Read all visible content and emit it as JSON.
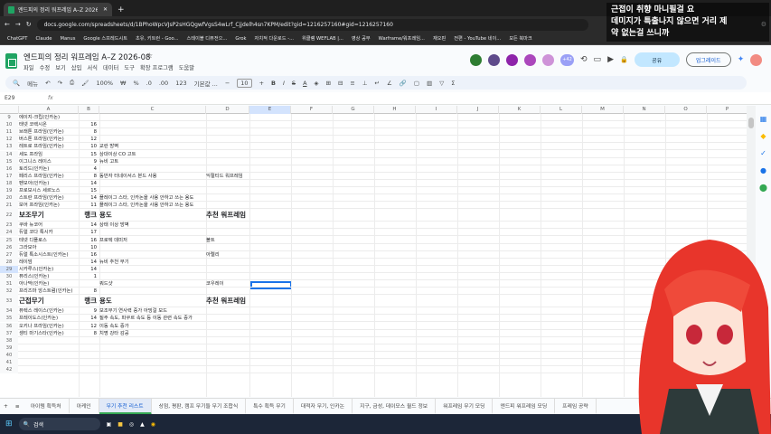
{
  "browser": {
    "tab_title": "엔드피의 정리 워프레임 A–Z 2026-08",
    "url": "docs.google.com/spreadsheets/d/1BPhoWpcVJsP2sHGQgwfVgsS4wLrf_Cjjdelh4sn7KPM/edit?gid=1216257160#gid=1216257160",
    "bookmarks": [
      "ChatGPT",
      "Claude",
      "Manus",
      "Google 스프레드시트",
      "초유, 키트런 - Goo...",
      "스테이블 디퓨전으...",
      "Grok",
      "자치적 다운로드 -...",
      "위클램 WEFLAB |...",
      "영상 공부",
      "Warframe/워프레임...",
      "재오핀",
      "전편 - YouTube 네이..."
    ],
    "bookmarks_more": "모든 북마크"
  },
  "doc": {
    "title": "엔드피의 정리 워프레임 A–Z 2026-08",
    "menus": [
      "파일",
      "수정",
      "보기",
      "삽입",
      "서식",
      "데이터",
      "도구",
      "확장 프로그램",
      "도움말"
    ],
    "share": "공유",
    "upgrade": "업그레이드",
    "viewers_extra": "+42"
  },
  "toolbar": {
    "search": "메뉴",
    "zoom": "100%",
    "percent": "%",
    "decimal_dec": ".0",
    "decimal_inc": ".00",
    "num_fmt": "123",
    "font": "기본값 ...",
    "font_size": "10"
  },
  "formula": {
    "cell": "E29",
    "fx": "fx"
  },
  "columns": [
    "A",
    "B",
    "C",
    "D",
    "E",
    "F",
    "G",
    "H",
    "I",
    "J",
    "K",
    "L",
    "M",
    "N",
    "O",
    "P"
  ],
  "rows": [
    {
      "n": "9",
      "a": "에이지-크립(인카논)",
      "b": "",
      "c": "",
      "d": ""
    },
    {
      "n": "10",
      "a": "태넷 코렉시온",
      "b": "16",
      "c": "",
      "d": ""
    },
    {
      "n": "11",
      "a": "브래톤 프라임(인카논)",
      "b": "8",
      "c": "",
      "d": ""
    },
    {
      "n": "12",
      "a": "버스톤 프라임(인카논)",
      "b": "12",
      "c": "",
      "d": ""
    },
    {
      "n": "13",
      "a": "레트로 프라임(인카논)",
      "b": "10",
      "c": "교란 방벽",
      "d": ""
    },
    {
      "n": "14",
      "a": "세도 프라임",
      "b": "15",
      "c": "상대이상 CO 고트",
      "d": ""
    },
    {
      "n": "15",
      "a": "이그니스 레이스",
      "b": "9",
      "c": "뉴비 고트",
      "d": ""
    },
    {
      "n": "16",
      "a": "토리드(인카논)",
      "b": "4",
      "c": "",
      "d": ""
    },
    {
      "n": "17",
      "a": "페리스 프라임(인카논)",
      "b": "8",
      "c": "동반자 터네이서스 본드 사용",
      "d": "익절티드 워프레임"
    },
    {
      "n": "18",
      "a": "펜모아(인카논)",
      "b": "14",
      "c": "",
      "d": ""
    },
    {
      "n": "19",
      "a": "프로보시스 세르노스",
      "b": "15",
      "c": "",
      "d": ""
    },
    {
      "n": "20",
      "a": "스트란 프라임(인카논)",
      "b": "14",
      "c": "플레이그 스타, 인카논을 사용 안하고 쓰는 용도",
      "d": ""
    },
    {
      "n": "21",
      "a": "보어 프라임(인카논)",
      "b": "11",
      "c": "플레이그 스타, 인카논을 사용 안하고 쓰는 용도",
      "d": ""
    },
    {
      "n": "22",
      "a": "보조무기",
      "b": "랭크",
      "c": "용도",
      "d": "추천 워프레임",
      "hd": true
    },
    {
      "n": "23",
      "a": "쿠바 뉴코어",
      "b": "14",
      "c": "상태 이상 방벽",
      "d": ""
    },
    {
      "n": "24",
      "a": "듀얼 코다 톡시카",
      "b": "17",
      "c": "",
      "d": ""
    },
    {
      "n": "25",
      "a": "테넷 디플로스",
      "b": "16",
      "c": "프로텍 데미저",
      "d": "볼트"
    },
    {
      "n": "26",
      "a": "그라모아",
      "b": "10",
      "c": "",
      "d": ""
    },
    {
      "n": "27",
      "a": "듀얼 톡소시스트(인카논)",
      "b": "16",
      "c": "",
      "d": "아렐리"
    },
    {
      "n": "28",
      "a": "레이덤",
      "b": "14",
      "c": "뉴비 추천 무기",
      "d": ""
    },
    {
      "n": "29",
      "a": "시카루스(인카논)",
      "b": "14",
      "c": "",
      "d": ""
    },
    {
      "n": "30",
      "a": "퓨리스(인카논)",
      "b": "1",
      "c": "",
      "d": ""
    },
    {
      "n": "31",
      "a": "아나막(인카논)",
      "b": "",
      "c": "쿼드샷",
      "d": "코우레이"
    },
    {
      "n": "32",
      "a": "프리즈마 앙스트럼(인카논)",
      "b": "8",
      "c": "",
      "d": ""
    },
    {
      "n": "33",
      "a": "근접무기",
      "b": "랭크",
      "c": "용도",
      "d": "추천 워프레임",
      "hd": true
    },
    {
      "n": "34",
      "a": "퓨렉스 레이스(인카논)",
      "b": "9",
      "c": "보조무기 연사력 증가 아밍걸 모드",
      "d": ""
    },
    {
      "n": "35",
      "a": "프레이도스(인카논)",
      "b": "14",
      "c": "질주 속도, 파쿠르 속도 등 이동 관련 속도 증가",
      "d": ""
    },
    {
      "n": "36",
      "a": "오키나 프라임(인카논)",
      "b": "12",
      "c": "이동 속도 증가",
      "d": ""
    },
    {
      "n": "37",
      "a": "셍티 마기스타(인카논)",
      "b": "8",
      "c": "치명 강타 감공",
      "d": ""
    },
    {
      "n": "38",
      "a": "",
      "b": "",
      "c": "",
      "d": ""
    },
    {
      "n": "39",
      "a": "",
      "b": "",
      "c": "",
      "d": ""
    },
    {
      "n": "40",
      "a": "",
      "b": "",
      "c": "",
      "d": ""
    },
    {
      "n": "41",
      "a": "",
      "b": "",
      "c": "",
      "d": ""
    },
    {
      "n": "42",
      "a": "",
      "b": "",
      "c": "",
      "d": ""
    }
  ],
  "sheet_tabs": [
    "아이템 획득처",
    "아케인",
    "무기 추천 리스트",
    "상점, 평판, 캠프 무기들 무기 조합식",
    "특수 획득 무기",
    "대적자 무기, 인카논",
    "지구, 금성, 데이모스 월드 정보",
    "워프레임 무기 모딩",
    "엔드피 워프레임 모딩",
    "프레임 공략"
  ],
  "active_sheet": 2,
  "taskbar": {
    "search": "검색"
  },
  "overlay": {
    "caption": [
      "근접이 취향 마니필걸 요",
      "데미지가 특출나지 않으면 거리 제",
      "약 없는걸 쓰니까"
    ]
  },
  "colors": {
    "sheets_green": "#1fa463",
    "active_tab": "#0b57d0",
    "selection": "#1a73e8"
  }
}
